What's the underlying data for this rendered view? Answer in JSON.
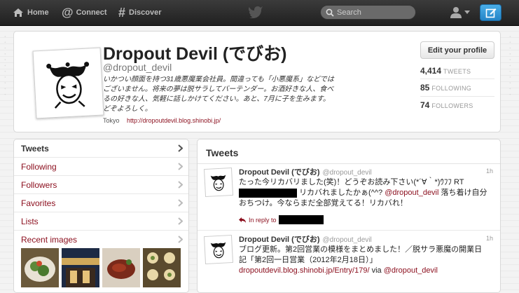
{
  "topbar": {
    "home_label": "Home",
    "connect_label": "Connect",
    "discover_label": "Discover",
    "search_placeholder": "Search"
  },
  "profile": {
    "name": "Dropout Devil (でびお)",
    "handle": "@dropout_devil",
    "bio": "いかつい顔面を持つ31歳悪魔業会社員。間違っても「小悪魔系」などではございません。将来の夢は脱サラしてバーテンダー。お酒好きな人、食べるの好きな人、気軽に話しかけてください。あと、7月に子を生みます。どぞよろしく。",
    "location": "Tokyo",
    "url": "http://dropoutdevil.blog.shinobi.jp/",
    "edit_button": "Edit your profile",
    "stats": [
      {
        "count": "4,414",
        "label": "TWEETS"
      },
      {
        "count": "85",
        "label": "FOLLOWING"
      },
      {
        "count": "74",
        "label": "FOLLOWERS"
      }
    ]
  },
  "leftnav": {
    "items": [
      {
        "label": "Tweets"
      },
      {
        "label": "Following"
      },
      {
        "label": "Followers"
      },
      {
        "label": "Favorites"
      },
      {
        "label": "Lists"
      },
      {
        "label": "Recent images"
      }
    ]
  },
  "tweets": {
    "heading": "Tweets",
    "list": [
      {
        "name": "Dropout Devil (でびお)",
        "handle": "@dropout_devil",
        "time": "1h",
        "text_1": "たった今リカバリました(笑)！どうぞお読み下さい(*´∀｀*)ｳﾌﾌ RT",
        "text_2": "リカバれましたかぁ(^^?",
        "mention": "@dropout_devil",
        "text_3": "落ち着け自分",
        "text_4": "おちつけ。今ならまだ全部覚えてる！リカバれ！",
        "reply_label": "In reply to"
      },
      {
        "name": "Dropout Devil (でびお)",
        "handle": "@dropout_devil",
        "time": "1h",
        "text_1": "ブログ更新。第2回営業の模様をまとめました！／脱サラ悪魔の開業日",
        "text_2": "記「第2回一日営業（2012年2月18日）」",
        "link": "dropoutdevil.blog.shinobi.jp/Entry/179/",
        "via": "via",
        "mention": "@dropout_devil"
      }
    ]
  },
  "colors": {
    "link": "#8b0e1d",
    "compose_button": "#2f93d8",
    "topbar": "#2b2b2b"
  }
}
